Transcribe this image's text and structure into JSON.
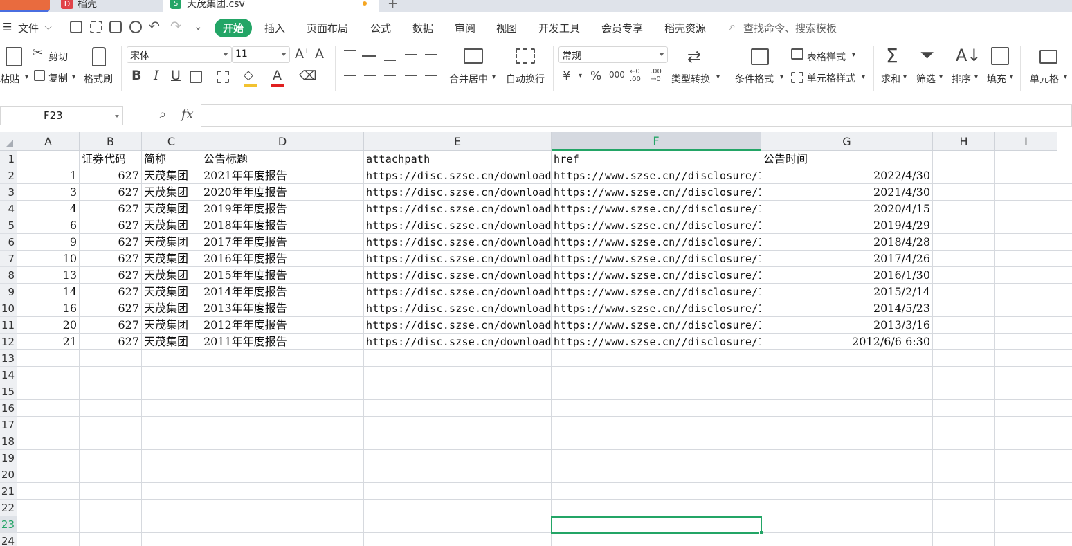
{
  "tabs": {
    "doke_label": "稻壳",
    "file_label": "天茂集团.csv"
  },
  "menu": {
    "file": "文件",
    "items": [
      "开始",
      "插入",
      "页面布局",
      "公式",
      "数据",
      "审阅",
      "视图",
      "开发工具",
      "会员专享",
      "稻壳资源"
    ],
    "search_placeholder": "查找命令、搜索模板"
  },
  "ribbon": {
    "paste": "粘贴",
    "cut": "剪切",
    "copy": "复制",
    "format_painter": "格式刷",
    "font_name": "宋体",
    "font_size": "11",
    "merge_center": "合并居中",
    "wrap_text": "自动换行",
    "number_format": "常规",
    "type_convert": "类型转换",
    "conditional_format": "条件格式",
    "table_style": "表格样式",
    "cell_style": "单元格样式",
    "sum": "求和",
    "filter": "筛选",
    "sort": "排序",
    "fill": "填充",
    "cell": "单元格"
  },
  "formula_bar": {
    "name_box": "F23",
    "fx": "fx",
    "formula": ""
  },
  "sheet": {
    "columns": [
      "A",
      "B",
      "C",
      "D",
      "E",
      "F",
      "G",
      "H",
      "I"
    ],
    "selected_column": "F",
    "selected_row": "23",
    "row_numbers": [
      "1",
      "2",
      "3",
      "4",
      "5",
      "6",
      "7",
      "8",
      "9",
      "10",
      "11",
      "12",
      "13",
      "14",
      "15",
      "16",
      "17",
      "18",
      "19",
      "20",
      "21",
      "22",
      "23",
      "24"
    ],
    "header_row": [
      "",
      "证券代码",
      "简称",
      "公告标题",
      "attachpath",
      "href",
      "公告时间"
    ],
    "rows": [
      [
        "1",
        "627",
        "天茂集团",
        "2021年年度报告",
        "https://disc.szse.cn/download/",
        "https://www.szse.cn//disclosure/1",
        "2022/4/30"
      ],
      [
        "3",
        "627",
        "天茂集团",
        "2020年年度报告",
        "https://disc.szse.cn/download/",
        "https://www.szse.cn//disclosure/1",
        "2021/4/30"
      ],
      [
        "4",
        "627",
        "天茂集团",
        "2019年年度报告",
        "https://disc.szse.cn/download/",
        "https://www.szse.cn//disclosure/1",
        "2020/4/15"
      ],
      [
        "6",
        "627",
        "天茂集团",
        "2018年年度报告",
        "https://disc.szse.cn/download/",
        "https://www.szse.cn//disclosure/1",
        "2019/4/29"
      ],
      [
        "9",
        "627",
        "天茂集团",
        "2017年年度报告",
        "https://disc.szse.cn/download/",
        "https://www.szse.cn//disclosure/1",
        "2018/4/28"
      ],
      [
        "10",
        "627",
        "天茂集团",
        "2016年年度报告",
        "https://disc.szse.cn/download/",
        "https://www.szse.cn//disclosure/1",
        "2017/4/26"
      ],
      [
        "13",
        "627",
        "天茂集团",
        "2015年年度报告",
        "https://disc.szse.cn/download/",
        "https://www.szse.cn//disclosure/1",
        "2016/1/30"
      ],
      [
        "14",
        "627",
        "天茂集团",
        "2014年年度报告",
        "https://disc.szse.cn/download/",
        "https://www.szse.cn//disclosure/1",
        "2015/2/14"
      ],
      [
        "16",
        "627",
        "天茂集团",
        "2013年年度报告",
        "https://disc.szse.cn/download/",
        "https://www.szse.cn//disclosure/1",
        "2014/5/23"
      ],
      [
        "20",
        "627",
        "天茂集团",
        "2012年年度报告",
        "https://disc.szse.cn/download/",
        "https://www.szse.cn//disclosure/1",
        "2013/3/16"
      ],
      [
        "21",
        "627",
        "天茂集团",
        "2011年年度报告",
        "https://disc.szse.cn/download/",
        "https://www.szse.cn//disclosure/1",
        "2012/6/6 6:30"
      ]
    ]
  },
  "colors": {
    "accent": "#23a566",
    "tab_bar": "#dfe3ea",
    "header_bg": "#eef0f3"
  }
}
